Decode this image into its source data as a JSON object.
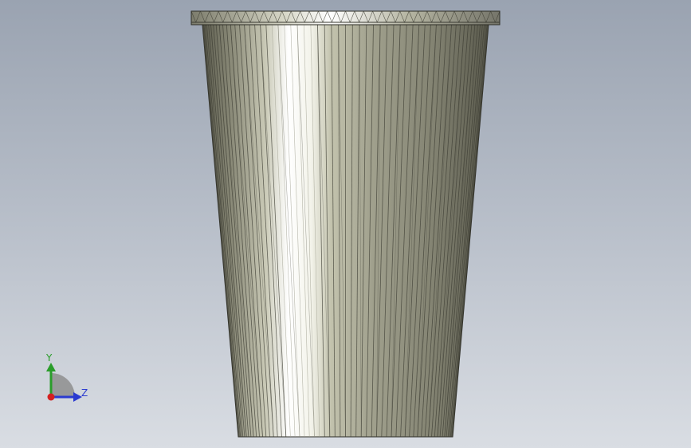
{
  "viewport": {
    "background_top": "#9aa3b1",
    "background_bottom": "#d9dde3"
  },
  "model": {
    "name": "cup",
    "shading_light": "#ffffff",
    "shading_dark": "#6a6a58"
  },
  "triad": {
    "y_label": "Y",
    "z_label": "Z",
    "y_color": "#2a9d2a",
    "z_color": "#2b3bd0",
    "x_color": "#d42020"
  }
}
